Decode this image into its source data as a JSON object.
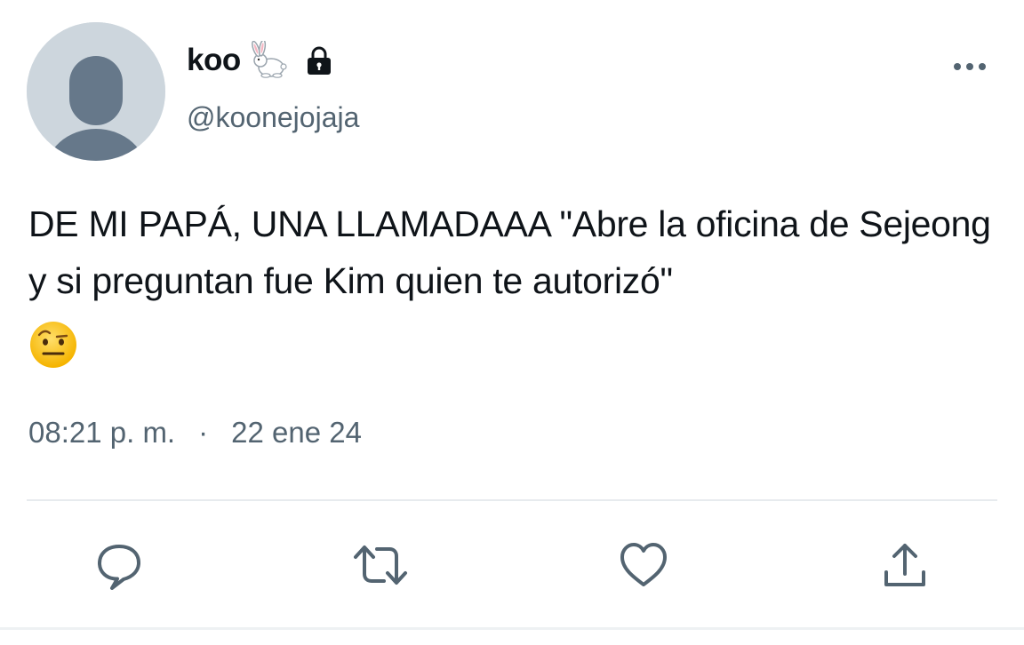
{
  "author": {
    "display_name": "koo",
    "handle": "@koonejojaja",
    "badge_icons": [
      "rabbit-emoji-icon",
      "lock-icon"
    ]
  },
  "tweet": {
    "text": "DE MI PAPÁ, UNA LLAMADAAA \"Abre la oficina de Sejeong y si preguntan fue Kim quien te autorizó\"",
    "trailing_emoji": "raised-eyebrow-face-emoji-icon",
    "time": "08:21 p. m.",
    "separator": "·",
    "date": "22 ene 24"
  },
  "actions": [
    "reply-icon",
    "retweet-icon",
    "like-icon",
    "share-icon"
  ],
  "colors": {
    "text_primary": "#0f1419",
    "text_secondary": "#536471",
    "icon": "#536471",
    "avatar_bg": "#cdd6dd",
    "avatar_silhouette": "#66788a",
    "divider": "#e7ebee"
  }
}
